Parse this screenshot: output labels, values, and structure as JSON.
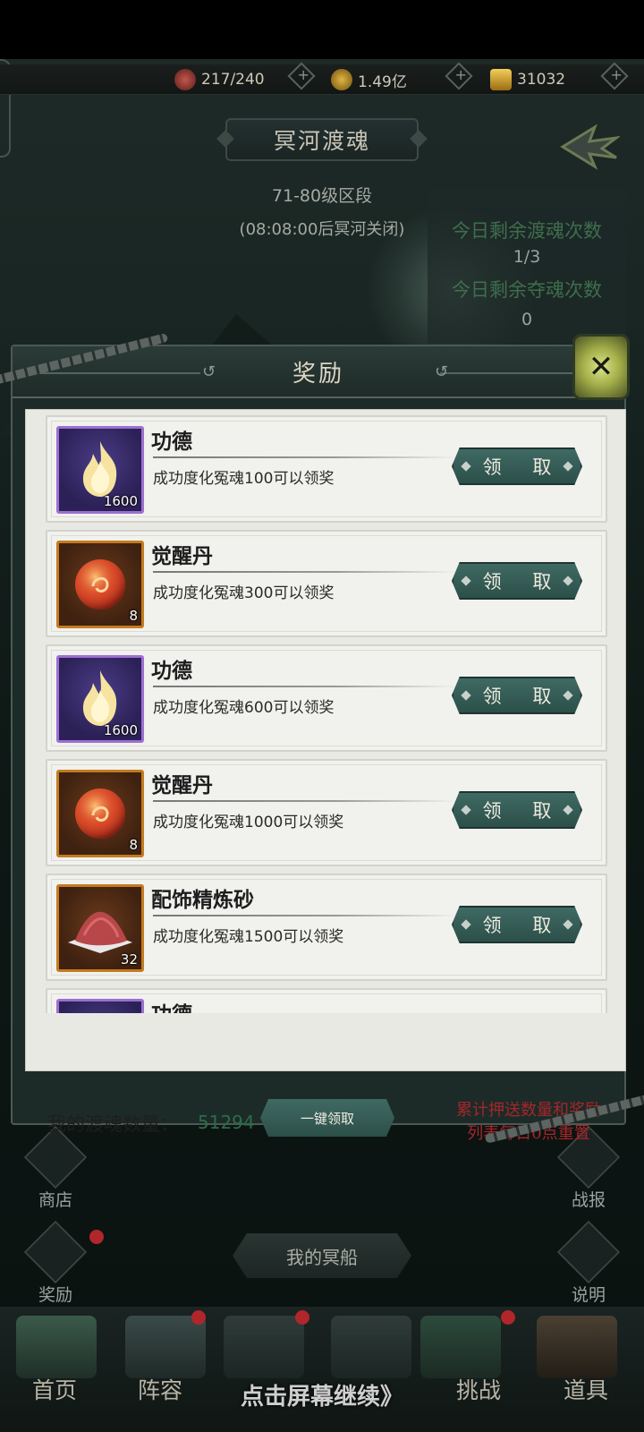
{
  "resources": {
    "stamina": "217/240",
    "silver": "1.49亿",
    "gold": "31032"
  },
  "screen": {
    "title": "冥河渡魂",
    "level_range": "71-80级区段",
    "close_countdown": "(08:08:00后冥河关闭)",
    "remaining_ferry_label": "今日剩余渡魂次数",
    "remaining_ferry_value": "1/3",
    "remaining_steal_label": "今日剩余夺魂次数",
    "remaining_steal_value": "0"
  },
  "modal": {
    "title": "奖励",
    "claim_label": "领 取",
    "rewards": [
      {
        "name": "功德",
        "desc": "成功度化冤魂100可以领奖",
        "count": "1600",
        "icon": "flame-icon"
      },
      {
        "name": "觉醒丹",
        "desc": "成功度化冤魂300可以领奖",
        "count": "8",
        "icon": "orb-icon"
      },
      {
        "name": "功德",
        "desc": "成功度化冤魂600可以领奖",
        "count": "1600",
        "icon": "flame-icon"
      },
      {
        "name": "觉醒丹",
        "desc": "成功度化冤魂1000可以领奖",
        "count": "8",
        "icon": "orb-icon"
      },
      {
        "name": "配饰精炼砂",
        "desc": "成功度化冤魂1500可以领奖",
        "count": "32",
        "icon": "sand-icon"
      },
      {
        "name": "功德",
        "icon": "flame-icon"
      }
    ],
    "footer": {
      "my_souls_label": "我的渡魂数量：",
      "my_souls_value": "51294",
      "one_click_label": "一键领取",
      "reset_note_line1": "累计押送数量和奖励",
      "reset_note_line2": "列表每日0点重置"
    }
  },
  "side_buttons": {
    "shop": "商店",
    "reward": "奖励",
    "battle_report": "战报",
    "help": "说明"
  },
  "my_ship_label": "我的冥船",
  "bottom_nav": [
    "首页",
    "阵容",
    "挑战",
    "道具"
  ],
  "continue_hint": "点击屏幕继续》",
  "colors": {
    "claim_button": "#2f524c",
    "purple_frame": "#9c6fd0",
    "orange_frame": "#c47b1e",
    "note_red": "#a4262b",
    "souls_green": "#2e6b49"
  }
}
